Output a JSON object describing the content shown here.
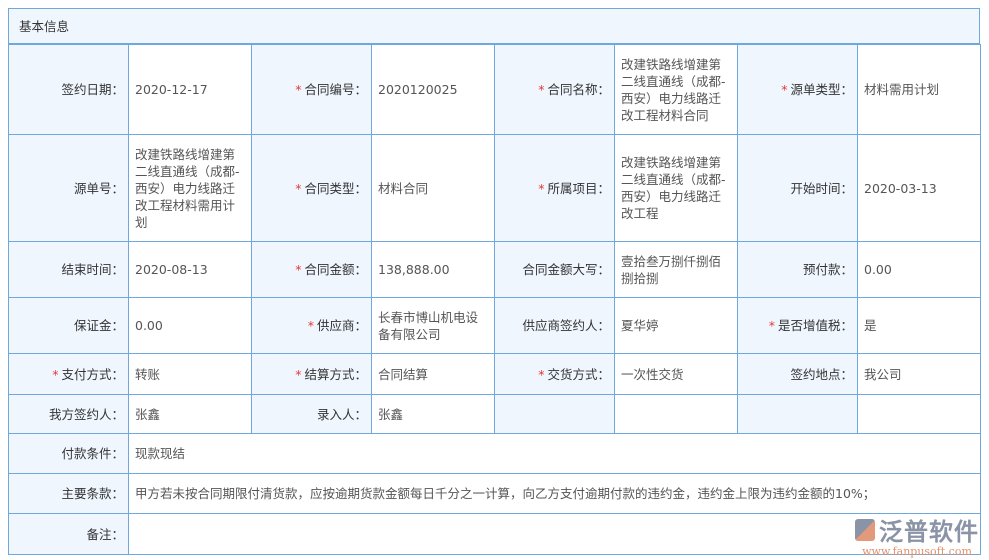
{
  "section_title": "基本信息",
  "rows": [
    [
      {
        "l": "签约日期：",
        "v": "2020-12-17"
      },
      {
        "l": "合同编号：",
        "v": "2020120025",
        "req": true
      },
      {
        "l": "合同名称：",
        "v": "改建铁路线增建第二线直通线（成都-西安）电力线路迁改工程材料合同",
        "req": true
      },
      {
        "l": "源单类型：",
        "v": "材料需用计划",
        "req": true
      }
    ],
    [
      {
        "l": "源单号：",
        "v": "改建铁路线增建第二线直通线（成都-西安）电力线路迁改工程材料需用计划"
      },
      {
        "l": "合同类型：",
        "v": "材料合同",
        "req": true
      },
      {
        "l": "所属项目：",
        "v": "改建铁路线增建第二线直通线（成都-西安）电力线路迁改工程",
        "req": true
      },
      {
        "l": "开始时间：",
        "v": "2020-03-13"
      }
    ],
    [
      {
        "l": "结束时间：",
        "v": "2020-08-13"
      },
      {
        "l": "合同金额：",
        "v": "138,888.00",
        "req": true
      },
      {
        "l": "合同金额大写：",
        "v": "壹拾叁万捌仟捌佰捌拾捌"
      },
      {
        "l": "预付款：",
        "v": "0.00"
      }
    ],
    [
      {
        "l": "保证金：",
        "v": "0.00"
      },
      {
        "l": "供应商：",
        "v": "长春市博山机电设备有限公司",
        "req": true
      },
      {
        "l": "供应商签约人：",
        "v": "夏华婷"
      },
      {
        "l": "是否增值税：",
        "v": "是",
        "req": true
      }
    ],
    [
      {
        "l": "支付方式：",
        "v": "转账",
        "req": true
      },
      {
        "l": "结算方式：",
        "v": "合同结算",
        "req": true
      },
      {
        "l": "交货方式：",
        "v": "一次性交货",
        "req": true
      },
      {
        "l": "签约地点：",
        "v": "我公司"
      }
    ],
    [
      {
        "l": "我方签约人：",
        "v": "张鑫"
      },
      {
        "l": "录入人：",
        "v": "张鑫"
      },
      {
        "l": "",
        "v": ""
      },
      {
        "l": "",
        "v": ""
      }
    ]
  ],
  "wide_rows": [
    {
      "l": "付款条件：",
      "v": "现款现结"
    },
    {
      "l": "主要条款：",
      "v": "甲方若未按合同期限付清货款，应按逾期货款金额每日千分之一计算，向乙方支付逾期付款的违约金，违约金上限为违约金额的10%；"
    },
    {
      "l": "备注：",
      "v": ""
    }
  ],
  "watermark": {
    "name": "泛普软件",
    "url": "www.fanpusoft.com"
  }
}
